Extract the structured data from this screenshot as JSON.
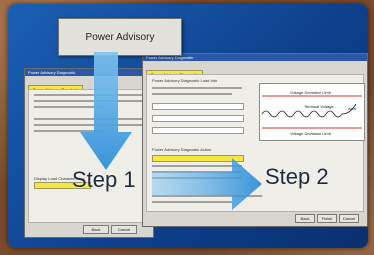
{
  "banner": {
    "title": "Power Advisory"
  },
  "step1": {
    "label": "Step 1",
    "window_title": "Power Advisory Diagnostic",
    "tab": "Power Advisory Template",
    "field_label": "Display Load Characteristics",
    "buttons": [
      "Back",
      "Cancel"
    ]
  },
  "step2": {
    "label": "Step 2",
    "window_title": "Power Advisory Diagnostic",
    "tab": "Power Advisory Diagnostic",
    "section1": "Power Advisory Diagnostic Load Info",
    "section2": "Power Advisory Diagnostic Action",
    "buttons": [
      "Back",
      "Finish",
      "Cancel"
    ],
    "diagram": {
      "upper_limit": "Voltage Deviation Limit",
      "terminal": "Terminal Voltage",
      "alert": "Alert",
      "lower_limit": "Voltage Deviation Limit"
    }
  },
  "colors": {
    "panel": "#1b5fb4",
    "arrow": "#3aa0e8",
    "highlight": "#f7e743",
    "limit_line": "#d0352b"
  }
}
